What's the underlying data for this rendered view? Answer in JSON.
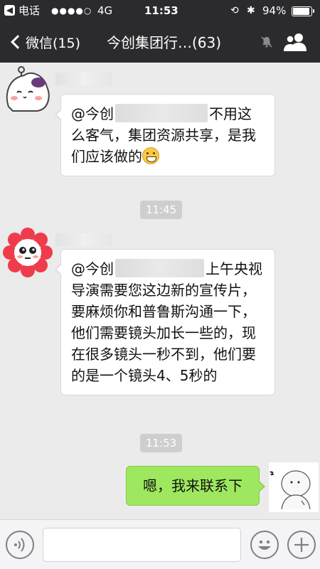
{
  "status_bar": {
    "back_app": "电话",
    "signal": "●●●●○",
    "network": "4G",
    "time": "11:53",
    "battery_percent": "94%",
    "battery_level": 0.94
  },
  "nav": {
    "back_label": "微信(15)",
    "title": "今创集团行…(63)"
  },
  "messages": [
    {
      "text_before": "@今创",
      "text_after": "不用这么客气，集团资源共享，是我们应该做的"
    },
    {
      "time": "11:45",
      "text_before": "@今创",
      "text_after": "上午央视导演需要您这边新的宣传片，要麻烦你和普鲁斯沟通一下，他们需要镜头加长一些的，现在很多镜头一秒不到，他们要的是一个镜头4、5秒的"
    },
    {
      "time": "11:53",
      "text": "嗯，我来联系下"
    }
  ],
  "colors": {
    "topbar": "#2b2b2e",
    "chat_bg": "#ebebeb",
    "outgoing_bubble": "#9ee85f"
  }
}
